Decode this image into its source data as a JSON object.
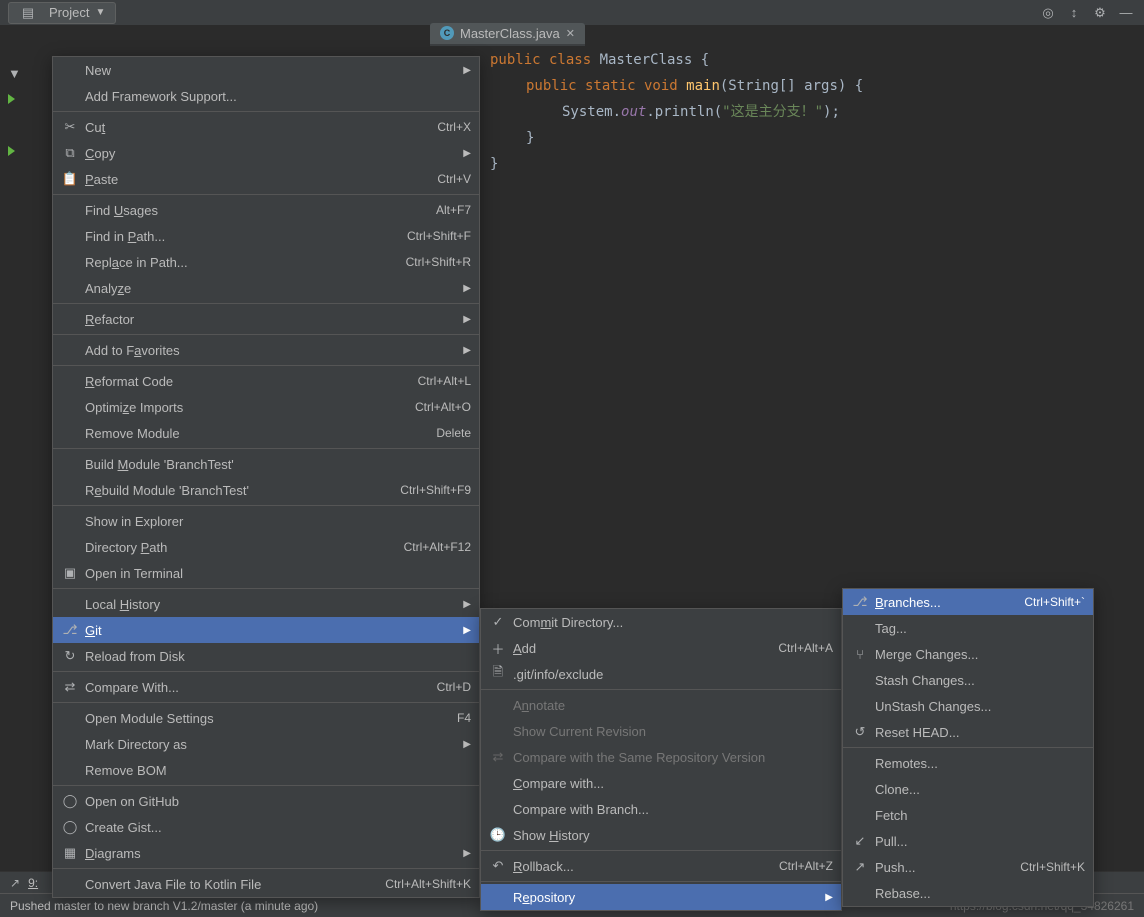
{
  "toolbar": {
    "project_label": "Project"
  },
  "editor": {
    "tab_name": "MasterClass.java",
    "code": {
      "line1_a": "public class ",
      "line1_b": "MasterClass ",
      "line1_c": "{",
      "line2_a": "public static void ",
      "line2_b": "main",
      "line2_c": "(String[] args) {",
      "line3_a": "System.",
      "line3_b": "out",
      "line3_c": ".println(",
      "line3_d": "\"这是主分支！\"",
      "line3_e": ");",
      "line4": "}",
      "line5": "}"
    }
  },
  "contextMenu": [
    {
      "label": "New",
      "arrow": true
    },
    {
      "label": "Add Framework Support..."
    },
    {
      "sep": true
    },
    {
      "icon": "cut",
      "label_html": "Cu<u>t</u>",
      "shortcut": "Ctrl+X"
    },
    {
      "icon": "copy",
      "label_html": "<u>C</u>opy",
      "arrow": true
    },
    {
      "icon": "paste",
      "label_html": "<u>P</u>aste",
      "shortcut": "Ctrl+V"
    },
    {
      "sep": true
    },
    {
      "label_html": "Find <u>U</u>sages",
      "shortcut": "Alt+F7"
    },
    {
      "label_html": "Find in <u>P</u>ath...",
      "shortcut": "Ctrl+Shift+F"
    },
    {
      "label_html": "Repl<u>a</u>ce in Path...",
      "shortcut": "Ctrl+Shift+R"
    },
    {
      "label_html": "Analy<u>z</u>e",
      "arrow": true
    },
    {
      "sep": true
    },
    {
      "label_html": "<u>R</u>efactor",
      "arrow": true
    },
    {
      "sep": true
    },
    {
      "label_html": "Add to F<u>a</u>vorites",
      "arrow": true
    },
    {
      "sep": true
    },
    {
      "label_html": "<u>R</u>eformat Code",
      "shortcut": "Ctrl+Alt+L"
    },
    {
      "label_html": "Optimi<u>z</u>e Imports",
      "shortcut": "Ctrl+Alt+O"
    },
    {
      "label": "Remove Module",
      "shortcut": "Delete"
    },
    {
      "sep": true
    },
    {
      "label_html": "Build <u>M</u>odule 'BranchTest'"
    },
    {
      "label_html": "R<u>e</u>build Module 'BranchTest'",
      "shortcut": "Ctrl+Shift+F9"
    },
    {
      "sep": true
    },
    {
      "label": "Show in Explorer"
    },
    {
      "label_html": "Directory <u>P</u>ath",
      "shortcut": "Ctrl+Alt+F12"
    },
    {
      "icon": "terminal",
      "label": "Open in Terminal"
    },
    {
      "sep": true
    },
    {
      "label_html": "Local <u>H</u>istory",
      "arrow": true
    },
    {
      "icon": "git",
      "label_html": "<u>G</u>it",
      "arrow": true,
      "highlighted": true
    },
    {
      "icon": "reload",
      "label": "Reload from Disk"
    },
    {
      "sep": true
    },
    {
      "icon": "diff",
      "label": "Compare With...",
      "shortcut": "Ctrl+D"
    },
    {
      "sep": true
    },
    {
      "label": "Open Module Settings",
      "shortcut": "F4"
    },
    {
      "label": "Mark Directory as",
      "arrow": true
    },
    {
      "label": "Remove BOM"
    },
    {
      "sep": true
    },
    {
      "icon": "github",
      "label": "Open on GitHub"
    },
    {
      "icon": "github",
      "label": "Create Gist..."
    },
    {
      "icon": "diagram",
      "label_html": "<u>D</u>iagrams",
      "arrow": true
    },
    {
      "sep": true
    },
    {
      "label": "Convert Java File to Kotlin File",
      "shortcut": "Ctrl+Alt+Shift+K"
    }
  ],
  "gitSubmenu": [
    {
      "icon": "commit",
      "label_html": "Com<u>m</u>it Directory..."
    },
    {
      "icon": "plus",
      "label_html": "<u>A</u>dd",
      "shortcut": "Ctrl+Alt+A"
    },
    {
      "icon": "file",
      "label": ".git/info/exclude"
    },
    {
      "sep": true
    },
    {
      "label_html": "A<u>n</u>notate",
      "disabled": true
    },
    {
      "label": "Show Current Revision",
      "disabled": true
    },
    {
      "icon": "compare",
      "label": "Compare with the Same Repository Version",
      "disabled": true
    },
    {
      "label_html": "<u>C</u>ompare with..."
    },
    {
      "label": "Compare with Branch..."
    },
    {
      "icon": "history",
      "label_html": "Show <u>H</u>istory"
    },
    {
      "sep": true
    },
    {
      "icon": "rollback",
      "label_html": "<u>R</u>ollback...",
      "shortcut": "Ctrl+Alt+Z"
    },
    {
      "sep": true
    },
    {
      "label_html": "R<u>e</u>pository",
      "arrow": true,
      "highlighted": true
    }
  ],
  "repoSubmenu": [
    {
      "icon": "branch",
      "label_html": "<u>B</u>ranches...",
      "shortcut": "Ctrl+Shift+`",
      "highlighted": true
    },
    {
      "label": "Tag..."
    },
    {
      "icon": "merge",
      "label": "Merge Changes..."
    },
    {
      "label": "Stash Changes..."
    },
    {
      "label": "UnStash Changes..."
    },
    {
      "icon": "reset",
      "label": "Reset HEAD..."
    },
    {
      "sep": true
    },
    {
      "label": "Remotes..."
    },
    {
      "label": "Clone..."
    },
    {
      "label": "Fetch"
    },
    {
      "icon": "pull",
      "label": "Pull..."
    },
    {
      "icon": "push",
      "label": "Push...",
      "shortcut": "Ctrl+Shift+K"
    },
    {
      "label": "Rebase..."
    }
  ],
  "statusBar": {
    "bottom_tab": "9:",
    "message": "Pushed master to new branch V1.2/master (a minute ago)",
    "watermark": "https://blog.csdn.net/qq_34826261"
  }
}
